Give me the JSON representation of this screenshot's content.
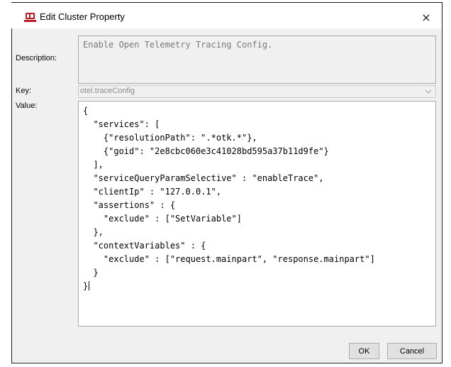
{
  "window": {
    "title": "Edit Cluster Property",
    "close_glyph": "×",
    "app_icon": "cluster-property-icon"
  },
  "form": {
    "description_label": "Description:",
    "description_value": "Enable Open Telemetry Tracing Config.",
    "key_label": "Key:",
    "key_value": "otel.traceConfig",
    "value_label": "Value:",
    "value_lines": [
      "{",
      "  \"services\": [",
      "    {\"resolutionPath\": \".*otk.*\"},",
      "    {\"goid\": \"2e8cbc060e3c41028bd595a37b11d9fe\"}",
      "  ],",
      "  \"serviceQueryParamSelective\" : \"enableTrace\",",
      "  \"clientIp\" : \"127.0.0.1\",",
      "  \"assertions\" : {",
      "    \"exclude\" : [\"SetVariable\"]",
      "  },",
      "  \"contextVariables\" : {",
      "    \"exclude\" : [\"request.mainpart\", \"response.mainpart\"]",
      "  }",
      "}"
    ]
  },
  "buttons": {
    "ok_label": "OK",
    "cancel_label": "Cancel"
  },
  "colors": {
    "icon_red": "#b5202a",
    "dialog_bg": "#f0f0f0"
  }
}
